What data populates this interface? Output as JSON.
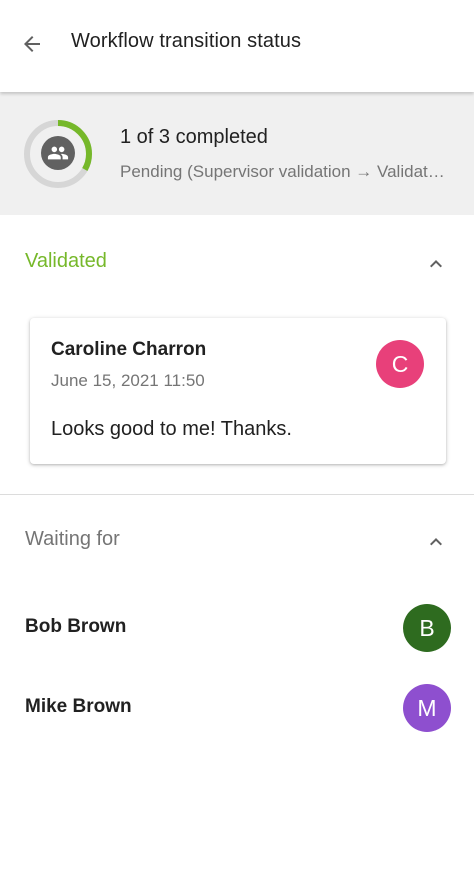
{
  "appbar": {
    "back_icon": "arrow-back-icon",
    "title": "Workflow transition status"
  },
  "summary": {
    "progress_fraction": 0.333,
    "progress_color": "#76b82a",
    "track_color": "#d6d6d6",
    "icon": "group-icon",
    "count_text": "1 of 3 completed",
    "status_text": "Pending (Supervisor validation → Validated)"
  },
  "validated": {
    "title": "Validated",
    "title_color": "#76b82a",
    "chevron_icon": "chevron-up-icon",
    "card": {
      "author": "Caroline Charron",
      "date": "June 15, 2021 11:50",
      "comment": "Looks good to me! Thanks.",
      "avatar_letter": "C",
      "avatar_color": "#e8407a"
    }
  },
  "waiting": {
    "title": "Waiting for",
    "chevron_icon": "chevron-up-icon",
    "people": [
      {
        "name": "Bob Brown",
        "avatar_letter": "B",
        "avatar_color": "#2e6b1f"
      },
      {
        "name": "Mike Brown",
        "avatar_letter": "M",
        "avatar_color": "#8e4fcf"
      }
    ]
  }
}
